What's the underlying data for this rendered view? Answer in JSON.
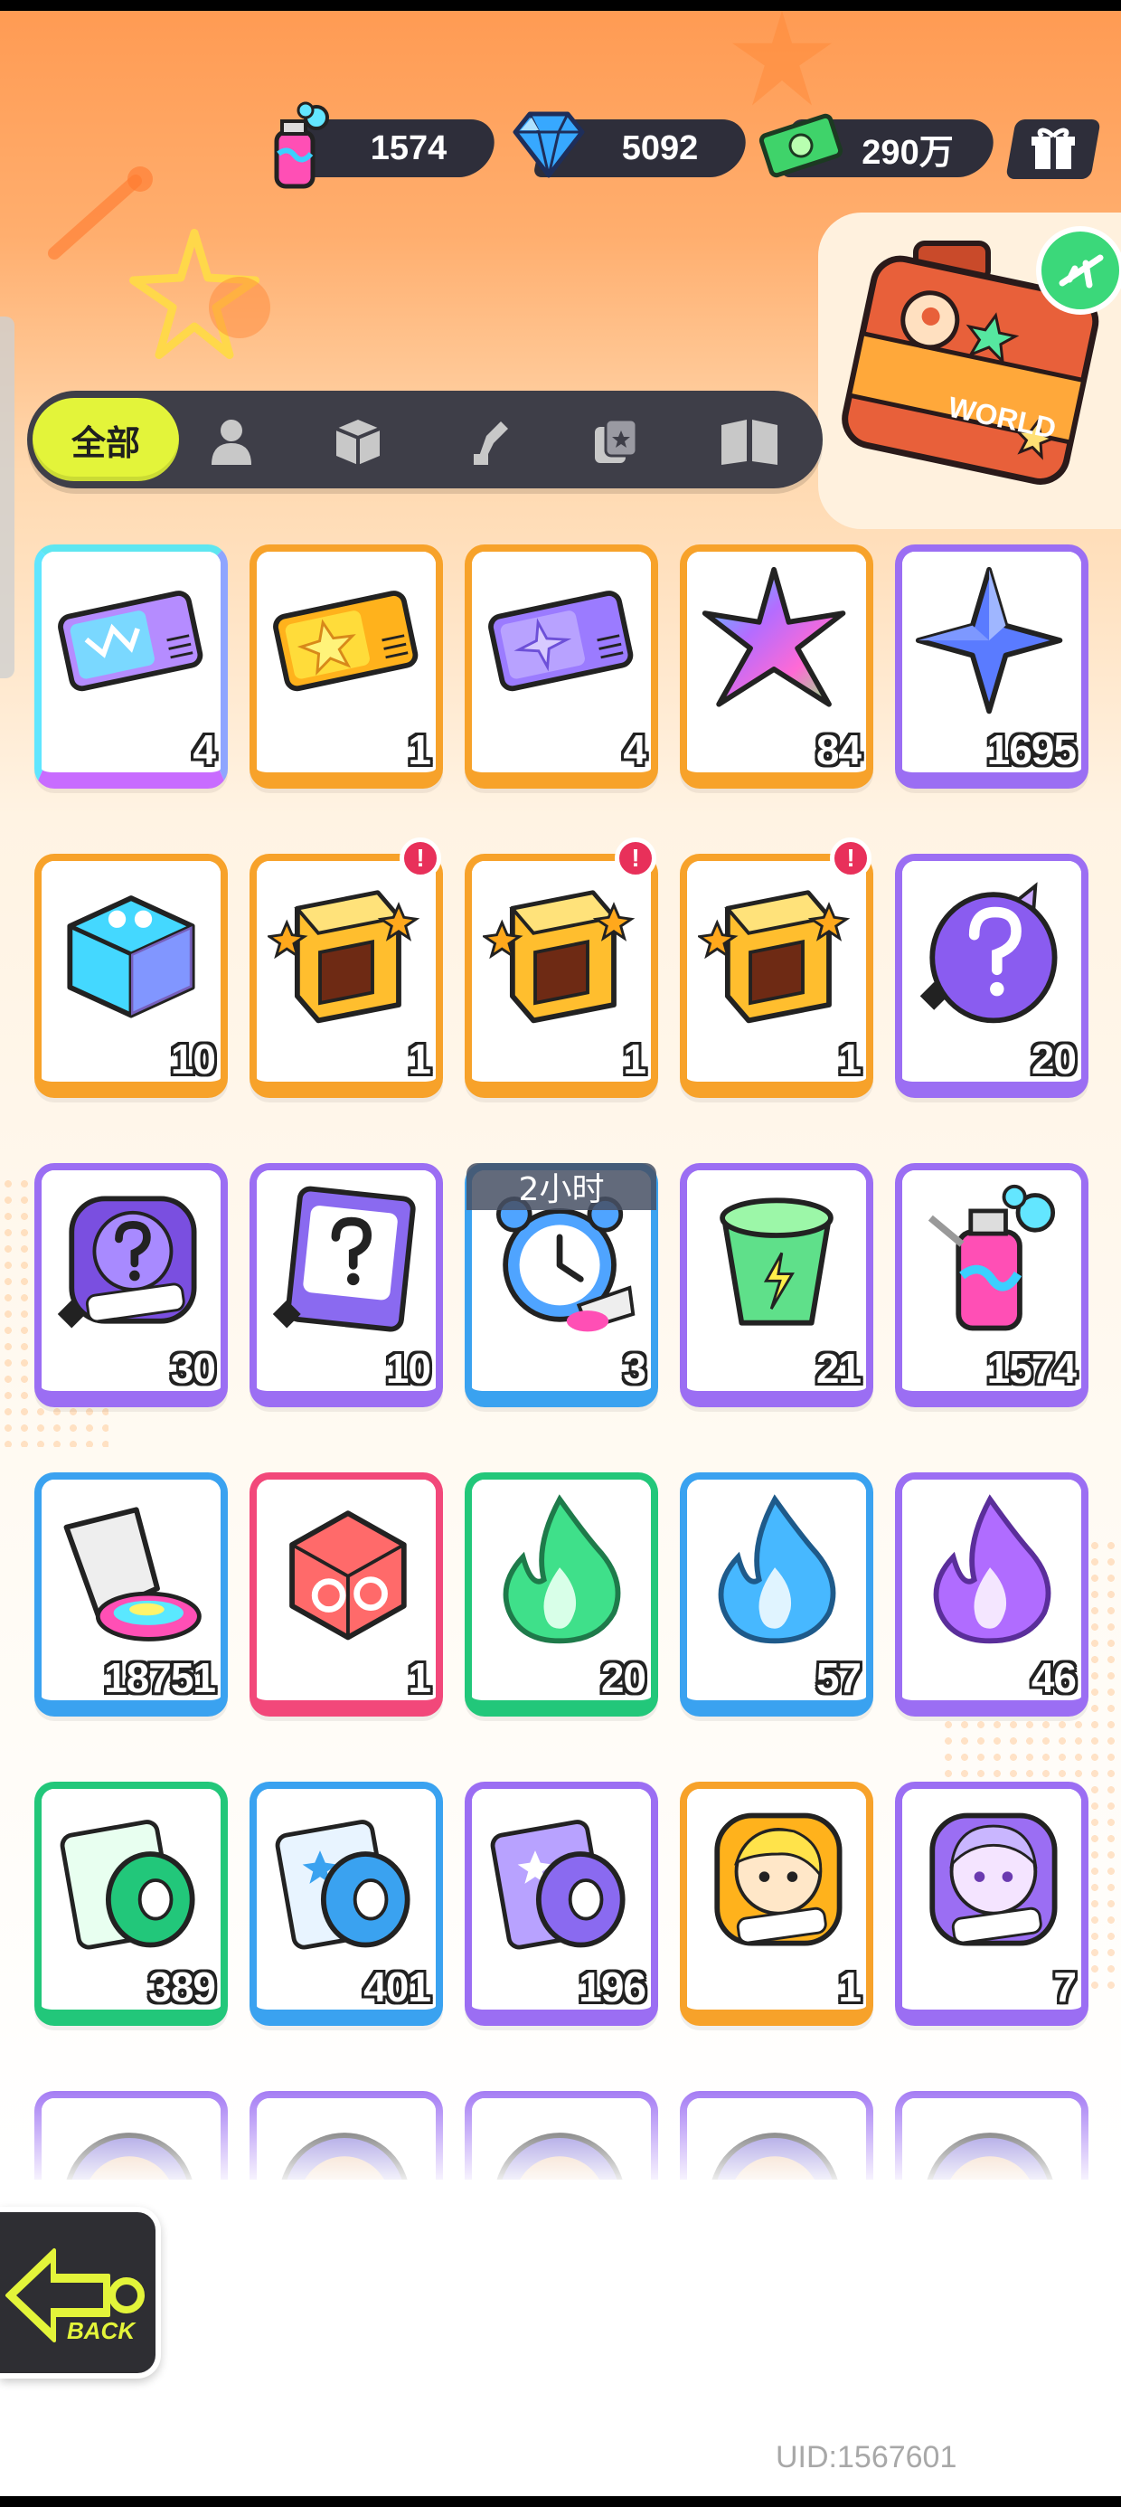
{
  "currencies": [
    {
      "name": "spray-paint",
      "value": "1574"
    },
    {
      "name": "diamond",
      "value": "5092"
    },
    {
      "name": "cash",
      "value": "290万"
    }
  ],
  "tabs": {
    "active_label": "全部",
    "icons": [
      "person-icon",
      "box-icon",
      "tool-icon",
      "card-icon",
      "book-icon"
    ]
  },
  "world_label": "WORLD",
  "timer_label": "2小时",
  "items": [
    {
      "icon": "rainbow-ticket-icon",
      "count": "4",
      "frame": "rainbow"
    },
    {
      "icon": "gold-ticket-icon",
      "count": "1",
      "frame": "orange"
    },
    {
      "icon": "purple-ticket-icon",
      "count": "4",
      "frame": "orange"
    },
    {
      "icon": "rainbow-crystal-icon",
      "count": "84",
      "frame": "orange"
    },
    {
      "icon": "blue-crystal-icon",
      "count": "1695",
      "frame": "purple"
    },
    {
      "icon": "dice-box-icon",
      "count": "10",
      "frame": "orange"
    },
    {
      "icon": "deity-pack-icon",
      "count": "1",
      "frame": "orange",
      "badge": "!"
    },
    {
      "icon": "deity-pack-icon",
      "count": "1",
      "frame": "orange",
      "badge": "!"
    },
    {
      "icon": "deity-pack-icon",
      "count": "1",
      "frame": "orange",
      "badge": "!"
    },
    {
      "icon": "mystery-egg-icon",
      "count": "20",
      "frame": "purple"
    },
    {
      "icon": "deity-mystery-badge-icon",
      "count": "30",
      "frame": "purple"
    },
    {
      "icon": "travel-mystery-card-icon",
      "count": "10",
      "frame": "purple"
    },
    {
      "icon": "alarm-clock-icon",
      "count": "3",
      "frame": "blue"
    },
    {
      "icon": "green-drink-cup-icon",
      "count": "21",
      "frame": "purple"
    },
    {
      "icon": "spray-can-icon",
      "count": "1574",
      "frame": "purple"
    },
    {
      "icon": "paint-tube-icon",
      "count": "18751",
      "frame": "blue"
    },
    {
      "icon": "red-go-dice-icon",
      "count": "1",
      "frame": "red"
    },
    {
      "icon": "green-flame-icon",
      "count": "20",
      "frame": "green"
    },
    {
      "icon": "blue-flame-icon",
      "count": "57",
      "frame": "blue"
    },
    {
      "icon": "purple-flame-icon",
      "count": "46",
      "frame": "purple"
    },
    {
      "icon": "green-tape-cards-icon",
      "count": "389",
      "frame": "green"
    },
    {
      "icon": "blue-tape-cards-icon",
      "count": "401",
      "frame": "blue"
    },
    {
      "icon": "purple-tape-cards-icon",
      "count": "196",
      "frame": "purple"
    },
    {
      "icon": "deity-gold-character-icon",
      "count": "1",
      "frame": "orange"
    },
    {
      "icon": "deity-purple-character-icon",
      "count": "7",
      "frame": "purple"
    },
    {
      "icon": "character-portrait-icon",
      "count": "",
      "frame": "purple"
    },
    {
      "icon": "character-portrait-icon",
      "count": "",
      "frame": "purple"
    },
    {
      "icon": "character-portrait-icon",
      "count": "",
      "frame": "purple"
    },
    {
      "icon": "character-portrait-icon",
      "count": "",
      "frame": "purple"
    },
    {
      "icon": "character-portrait-icon",
      "count": "",
      "frame": "purple"
    }
  ],
  "back_label": "BACK",
  "uid": "UID:1567601"
}
